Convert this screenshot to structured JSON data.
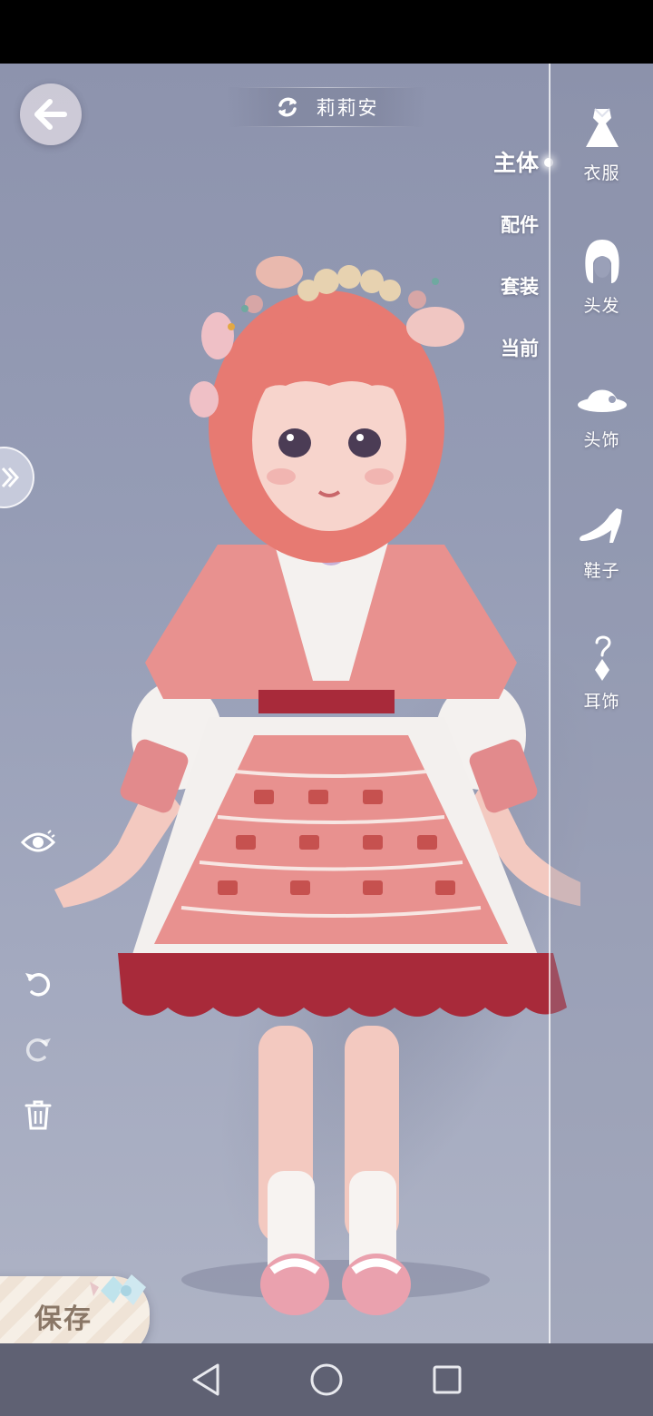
{
  "header": {
    "character_name": "莉莉安"
  },
  "category_tabs": [
    {
      "label": "主体",
      "active": true
    },
    {
      "label": "配件",
      "active": false
    },
    {
      "label": "套装",
      "active": false
    },
    {
      "label": "当前",
      "active": false
    }
  ],
  "sidebar": {
    "items": [
      {
        "label": "衣服",
        "icon": "dress-icon"
      },
      {
        "label": "头发",
        "icon": "hair-icon"
      },
      {
        "label": "头饰",
        "icon": "hat-icon"
      },
      {
        "label": "鞋子",
        "icon": "shoe-icon"
      },
      {
        "label": "耳饰",
        "icon": "earring-icon"
      }
    ]
  },
  "tools": [
    {
      "name": "visibility",
      "icon": "eye-icon"
    },
    {
      "name": "undo",
      "icon": "undo-icon"
    },
    {
      "name": "redo",
      "icon": "redo-icon"
    },
    {
      "name": "delete",
      "icon": "trash-icon"
    }
  ],
  "save": {
    "label": "保存"
  },
  "colors": {
    "background": "#959cb5",
    "dress_pink": "#e8918f",
    "lace_red": "#a82a3a",
    "hair": "#e77a72"
  }
}
